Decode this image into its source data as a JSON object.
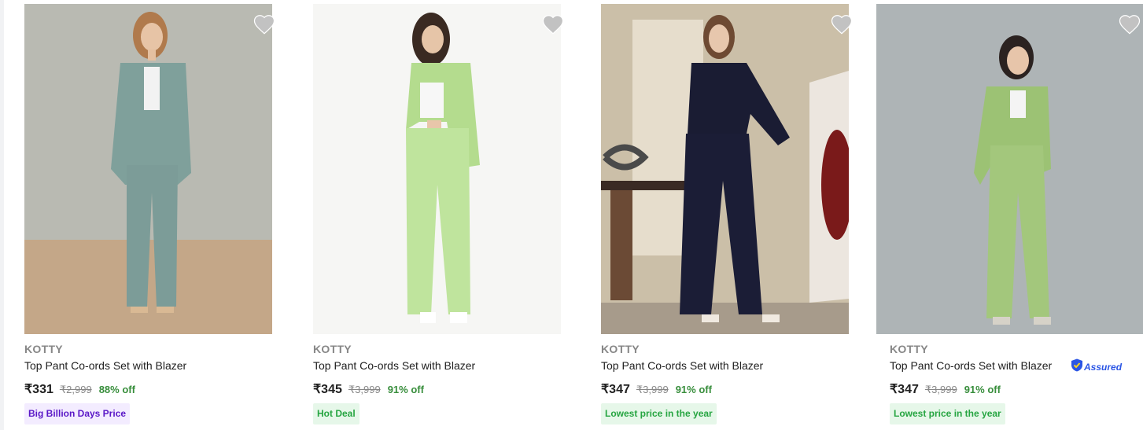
{
  "products": [
    {
      "brand": "KOTTY",
      "title": "Top Pant Co-ords Set with Blazer",
      "price": "₹331",
      "mrp": "₹2,999",
      "discount": "88% off",
      "badge": "Big Billion Days Price",
      "badge_style": "purple",
      "assured": false
    },
    {
      "brand": "KOTTY",
      "title": "Top Pant Co-ords Set with Blazer",
      "price": "₹345",
      "mrp": "₹3,999",
      "discount": "91% off",
      "badge": "Hot Deal",
      "badge_style": "green",
      "assured": false
    },
    {
      "brand": "KOTTY",
      "title": "Top Pant Co-ords Set with Blazer",
      "price": "₹347",
      "mrp": "₹3,999",
      "discount": "91% off",
      "badge": "Lowest price in the year",
      "badge_style": "green",
      "assured": false
    },
    {
      "brand": "KOTTY",
      "title": "Top Pant Co-ords Set with Blazer",
      "price": "₹347",
      "mrp": "₹3,999",
      "discount": "91% off",
      "badge": "Lowest price in the year",
      "badge_style": "green",
      "assured": true,
      "assured_label": "Assured"
    }
  ],
  "icons": {
    "wishlist": "heart-icon",
    "assured": "assured-shield-icon"
  },
  "colors": {
    "discount": "#388e3c",
    "badge_green_text": "#26a541",
    "badge_purple_text": "#5a18c7",
    "assured": "#2a55e5",
    "heart": "#c2c2c2"
  }
}
